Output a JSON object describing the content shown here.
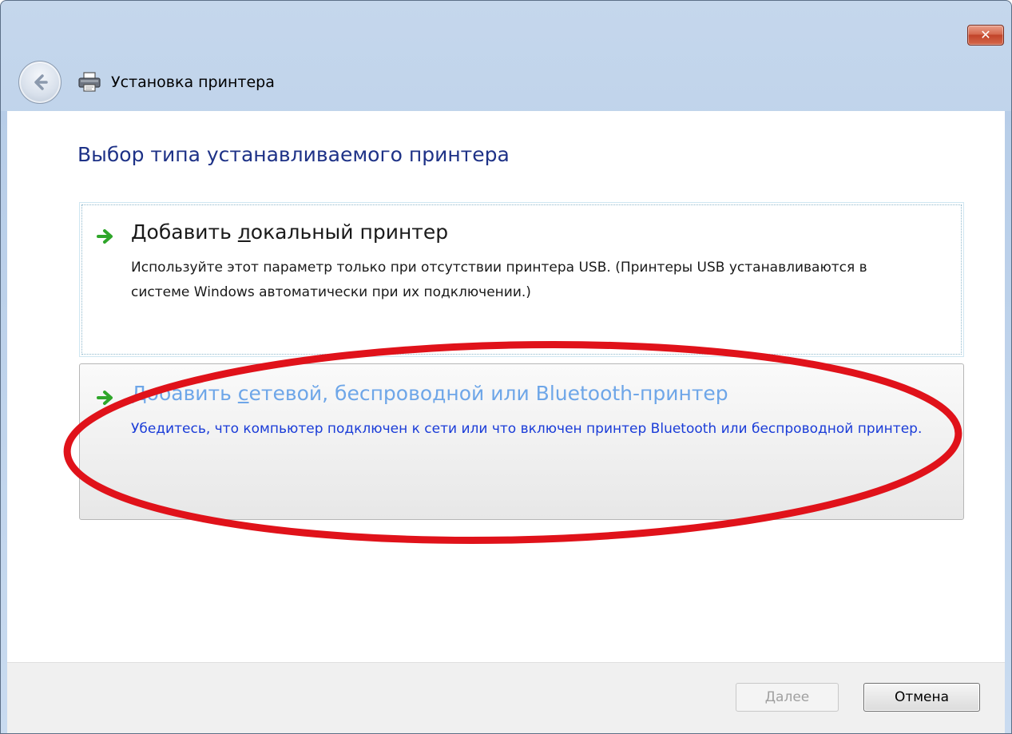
{
  "window": {
    "title": "Установка принтера",
    "close_glyph": "✕"
  },
  "page": {
    "heading": "Выбор типа устанавливаемого принтера"
  },
  "options": [
    {
      "title_pre": "Добавить ",
      "title_mnemonic": "л",
      "title_post": "окальный принтер",
      "description": "Используйте этот параметр только при отсутствии принтера USB. (Принтеры USB устанавливаются в системе Windows автоматически при их подключении.)",
      "icon": "green-arrow-icon"
    },
    {
      "title_pre": "Добавить ",
      "title_mnemonic": "с",
      "title_post": "етевой, беспроводной или Bluetooth-принтер",
      "description": "Убедитесь, что компьютер подключен к сети или что включен принтер Bluetooth или беспроводной принтер.",
      "icon": "green-arrow-icon"
    }
  ],
  "footer": {
    "next_mnemonic": "Д",
    "next_post": "алее",
    "cancel_label": "Отмена"
  },
  "annotation": {
    "color": "#e0121a"
  },
  "colors": {
    "heading": "#1e3287",
    "link_highlight": "#1a3cd8",
    "arrow_green": "#2fa62a"
  }
}
